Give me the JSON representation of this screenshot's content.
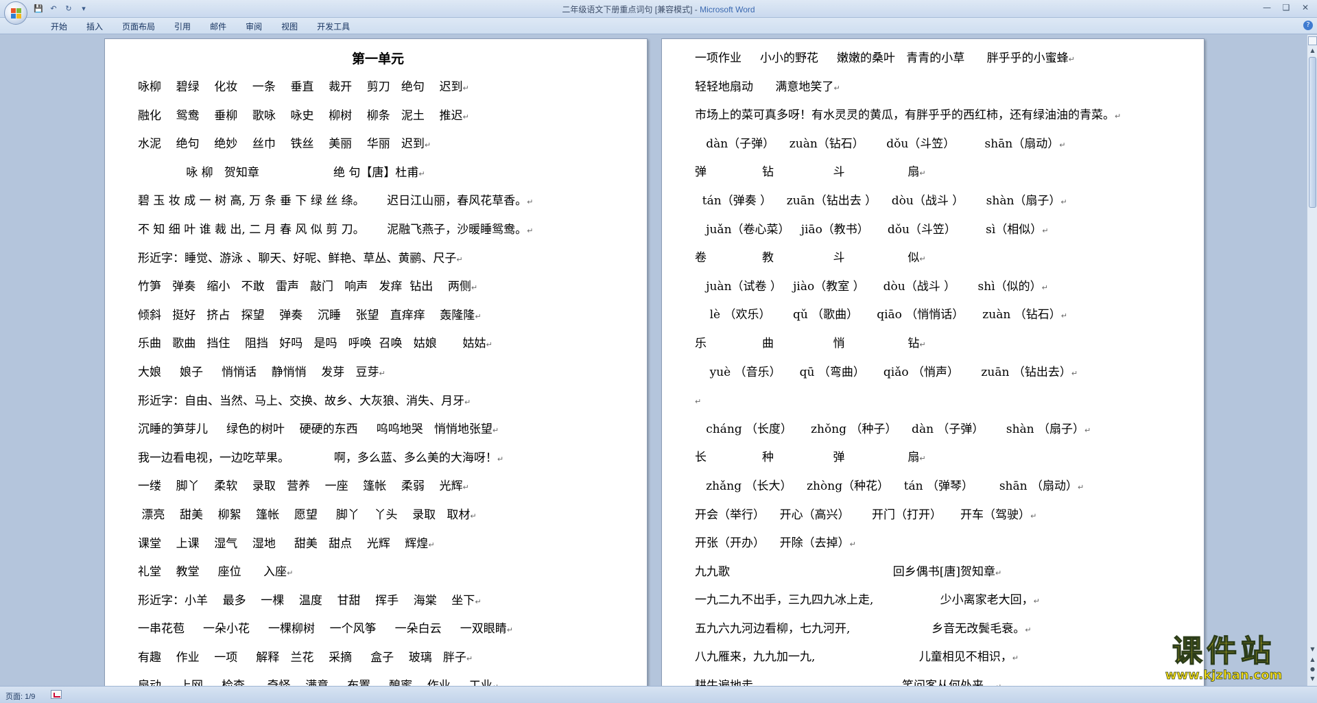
{
  "window": {
    "title": "二年级语文下册重点词句 [兼容模式] - ",
    "app": "Microsoft Word"
  },
  "ribbon": {
    "tabs": [
      "开始",
      "插入",
      "页面布局",
      "引用",
      "邮件",
      "审阅",
      "视图",
      "开发工具"
    ]
  },
  "status": {
    "page": "页面: 1/9"
  },
  "watermark": {
    "big": "课件站",
    "small": "www.kjzhan.com"
  },
  "left_page": {
    "heading": "第一单元",
    "lines": [
      "咏柳    碧绿    化妆    一条    垂直    裁开    剪刀   绝句    迟到",
      "融化    鸳鸯    垂柳    歌咏    咏史    柳树    柳条   泥土    推迟",
      "水泥    绝句    绝妙    丝巾    铁丝    美丽    华丽   迟到",
      "             咏 柳   贺知章                    绝 句【唐】杜甫",
      "碧 玉 妆 成 一 树 高, 万 条 垂 下 绿 丝 绦。      迟日江山丽，春风花草香。",
      "不 知 细 叶 谁 裁 出, 二 月 春 风 似 剪 刀。      泥融飞燕子，沙暖睡鸳鸯。",
      "形近字：睡觉、游泳 、聊天、好呢、鲜艳、草丛、黄鹂、尺子",
      "竹笋   弹奏   缩小   不敢   雷声   敲门   响声   发痒  钻出    两侧",
      "倾斜   挺好   挤占   探望    弹奏    沉睡    张望   直痒痒    轰隆隆",
      "乐曲   歌曲   挡住    阻挡   好吗   是吗   呼唤  召唤   姑娘       姑姑",
      "大娘     娘子     悄悄话    静悄悄    发芽   豆芽",
      "形近字：自由、当然、马上、交换、故乡、大灰狼、消失、月牙",
      "沉睡的笋芽儿     绿色的树叶    硬硬的东西     呜呜地哭   悄悄地张望",
      "我一边看电视，一边吃苹果。            啊，多么蓝、多么美的大海呀！",
      "一缕    脚丫    柔软    录取   营养    一座    篷帐    柔弱    光辉",
      " 漂亮    甜美    柳絮    篷帐    愿望     脚丫    丫头    录取   取材",
      "课堂    上课    湿气    湿地     甜美   甜点    光辉    辉煌",
      "礼堂    教堂     座位      入座",
      "形近字：小羊    最多    一棵    温度    甘甜    挥手    海棠    坐下",
      "一串花苞     一朵小花     一棵柳树    一个风筝     一朵白云     一双眼睛",
      "有趣    作业    一项     解释   兰花    采摘     盒子    玻璃   胖子",
      "扇动     上网     检查      奇怪    满意     布置     酿蜜    作业     工业"
    ]
  },
  "right_page": {
    "lines": [
      "一项作业     小小的野花     嫩嫩的桑叶   青青的小草      胖乎乎的小蜜蜂",
      "轻轻地扇动      满意地笑了",
      "市场上的菜可真多呀！有水灵灵的黄瓜，有胖乎乎的西红柿，还有绿油油的青菜。",
      "   dàn（子弹）    zuàn（钻石）      dǒu（斗笠）        shān（扇动）",
      "弹               钻                斗                 扇",
      "  tán（弹奏 ）    zuān（钻出去 ）    dòu（战斗 ）      shàn（扇子）",
      "   juǎn（卷心菜）   jiāo（教书）     dǒu（斗笠）        sì（相似）",
      "卷               教                斗                 似",
      "   juàn（试卷 ）   jiào（教室 ）     dòu（战斗 ）      shì（似的）",
      "    lè （欢乐）      qǔ （歌曲）     qiāo （悄悄话）     zuàn （钻石）",
      "乐               曲                悄                 钻",
      "    yuè （音乐）     qū （弯曲）     qiǎo （悄声）      zuān （钻出去）",
      "",
      "   cháng （长度）     zhǒng （种子）    dàn （子弹）      shàn （扇子）",
      "长               种                弹                 扇",
      "   zhǎng （长大）    zhòng（种花）    tán （弹琴）       shān （扇动）",
      "开会（举行）    开心（高兴）      开门（打开）     开车（驾驶）",
      "开张（开办）    开除（去掉）",
      "九九歌                                            回乡偶书[唐]贺知章",
      "一九二九不出手，三九四九冰上走,                  少小离家老大回，",
      "五九六九河边看柳，七九河开,                      乡音无改鬓毛衰。",
      "八九雁来，九九加一九,                            儿童相见不相识，",
      "耕牛遍地走。                                     笑问客从何处来。"
    ]
  }
}
